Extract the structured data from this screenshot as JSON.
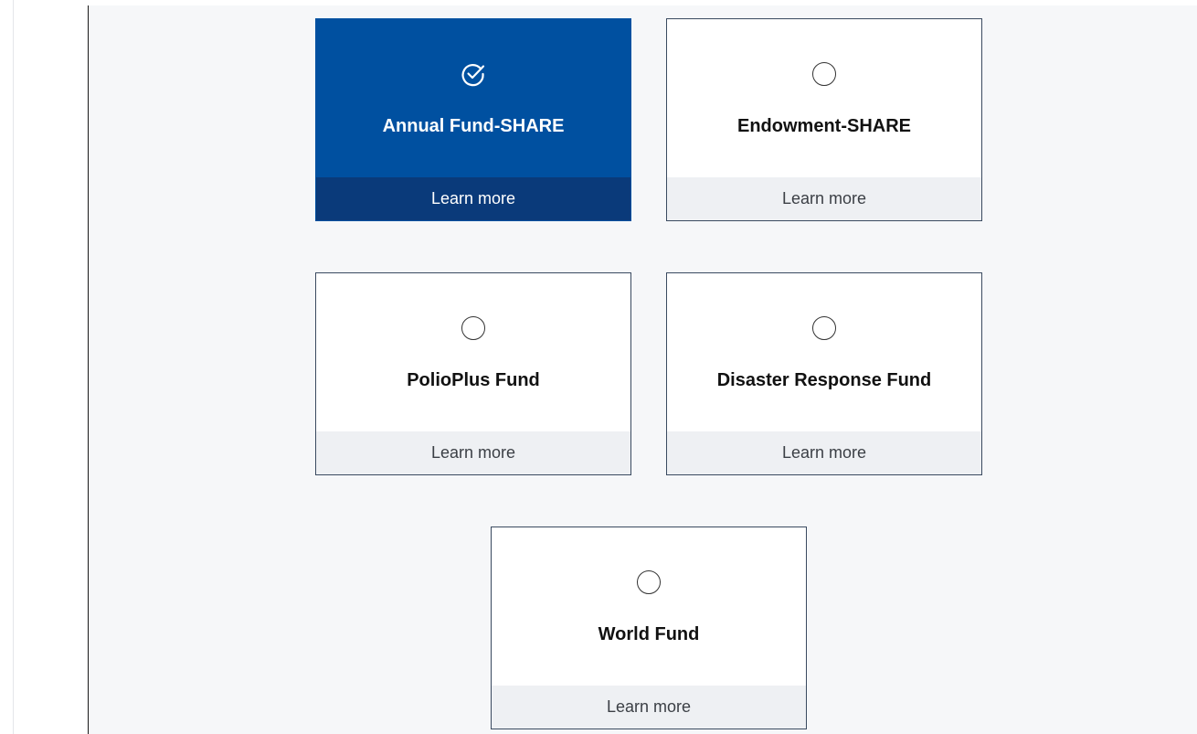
{
  "colors": {
    "selected_card": "#0050a0",
    "selected_footer": "#0a3a7a",
    "card_border": "#3a4a60",
    "footer_bg": "#eef0f3",
    "content_bg": "#f6f7f9"
  },
  "funds": [
    {
      "name": "Annual Fund-SHARE",
      "link": "Learn more",
      "selected": true,
      "icon": "check-circle-icon"
    },
    {
      "name": "Endowment-SHARE",
      "link": "Learn more",
      "selected": false,
      "icon": "radio-empty-icon"
    },
    {
      "name": "PolioPlus Fund",
      "link": "Learn more",
      "selected": false,
      "icon": "radio-empty-icon"
    },
    {
      "name": "Disaster Response Fund",
      "link": "Learn more",
      "selected": false,
      "icon": "radio-empty-icon"
    },
    {
      "name": "World Fund",
      "link": "Learn more",
      "selected": false,
      "icon": "radio-empty-icon"
    }
  ]
}
